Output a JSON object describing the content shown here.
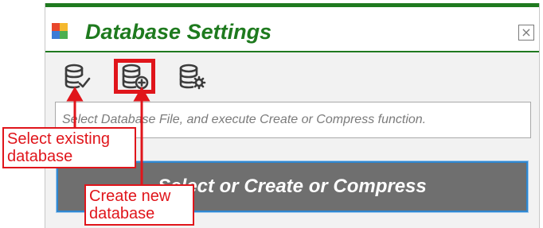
{
  "window": {
    "title": "Database Settings",
    "close_glyph": "×"
  },
  "toolbar": {
    "buttons": [
      {
        "name": "select-existing-database-button",
        "icon": "database-check-icon"
      },
      {
        "name": "create-new-database-button",
        "icon": "database-add-icon"
      },
      {
        "name": "compress-database-button",
        "icon": "database-gear-icon"
      }
    ]
  },
  "status_text": "Select Database File, and execute Create or Compress function.",
  "main_button_label": "Select or Create or Compress",
  "annotations": {
    "select_existing": [
      "Select existing",
      "database"
    ],
    "create_new": [
      "Create new",
      "database"
    ]
  },
  "colors": {
    "title_green": "#1e7a1e",
    "annotation_red": "#e0151b",
    "button_gray": "#6f6f6f",
    "button_border_blue": "#2f87d0"
  }
}
